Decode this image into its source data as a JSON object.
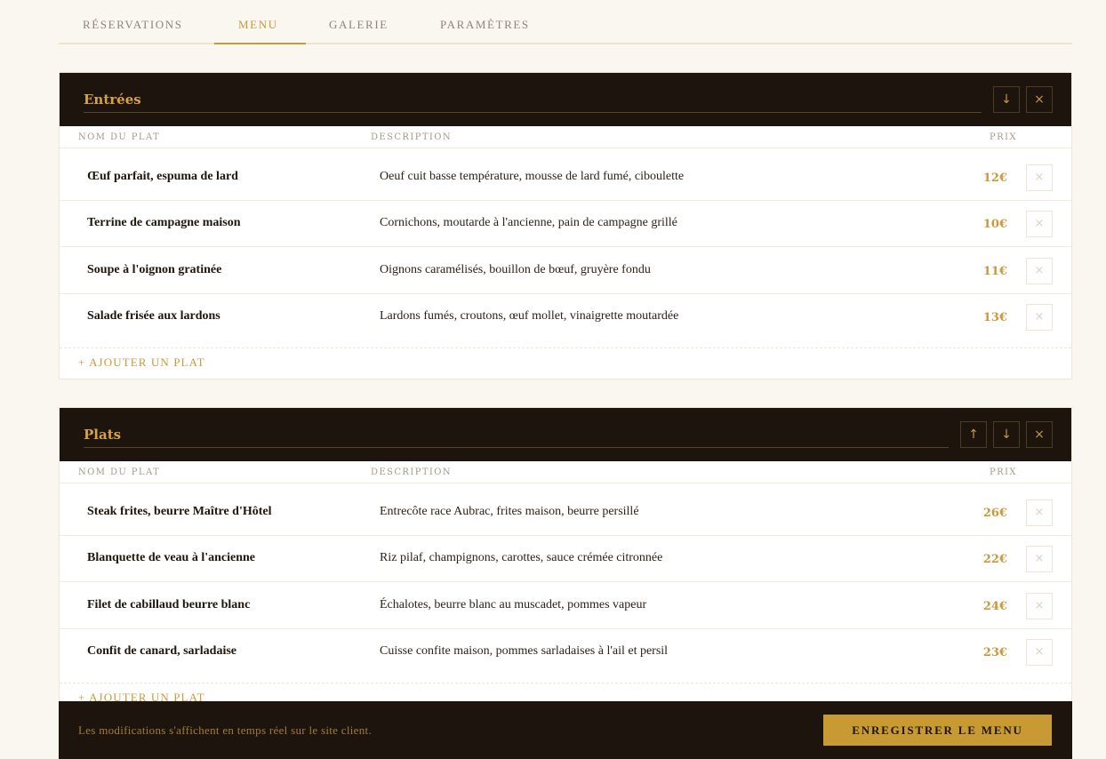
{
  "tabs": [
    {
      "label": "Réservations"
    },
    {
      "label": "Menu"
    },
    {
      "label": "Galerie"
    },
    {
      "label": "Paramètres"
    }
  ],
  "columns": {
    "name": "Nom du plat",
    "description": "Description",
    "price": "Prix"
  },
  "icons": {
    "up": "↑",
    "down": "↓",
    "close": "×"
  },
  "add_label": "+ Ajouter un plat",
  "sections": [
    {
      "title": "Entrées",
      "items": [
        {
          "name": "Œuf parfait, espuma de lard",
          "description": "Oeuf cuit basse température, mousse de lard fumé, ciboulette",
          "price": "12€"
        },
        {
          "name": "Terrine de campagne maison",
          "description": "Cornichons, moutarde à l'ancienne, pain de campagne grillé",
          "price": "10€"
        },
        {
          "name": "Soupe à l'oignon gratinée",
          "description": "Oignons caramélisés, bouillon de bœuf, gruyère fondu",
          "price": "11€"
        },
        {
          "name": "Salade frisée aux lardons",
          "description": "Lardons fumés, croutons, œuf mollet, vinaigrette moutardée",
          "price": "13€"
        }
      ]
    },
    {
      "title": "Plats",
      "items": [
        {
          "name": "Steak frites, beurre Maître d'Hôtel",
          "description": "Entrecôte race Aubrac, frites maison, beurre persillé",
          "price": "26€"
        },
        {
          "name": "Blanquette de veau à l'ancienne",
          "description": "Riz pilaf, champignons, carottes, sauce crémée citronnée",
          "price": "22€"
        },
        {
          "name": "Filet de cabillaud beurre blanc",
          "description": "Échalotes, beurre blanc au muscadet, pommes vapeur",
          "price": "24€"
        },
        {
          "name": "Confit de canard, sarladaise",
          "description": "Cuisse confite maison, pommes sarladaises à l'ail et persil",
          "price": "23€"
        }
      ]
    }
  ],
  "footer": {
    "message": "Les modifications s'affichent en temps réel sur le site client.",
    "save_label": "Enregistrer le menu"
  },
  "colors": {
    "accent": "#c79a3b",
    "dark": "#1c140d",
    "background": "#faf6f0"
  }
}
